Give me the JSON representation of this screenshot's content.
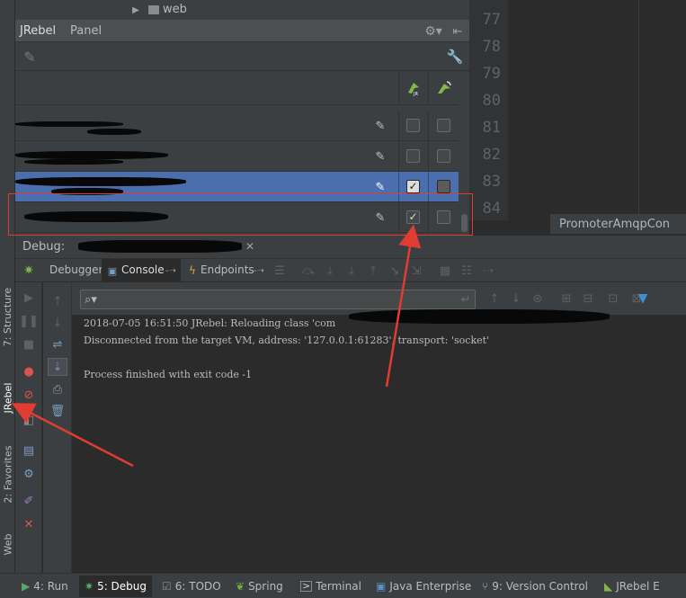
{
  "tree": {
    "folder": "web"
  },
  "panel": {
    "tabs": [
      "JRebel",
      "Panel"
    ],
    "rows": [
      {
        "enabled": false,
        "remote": false,
        "selected": false
      },
      {
        "enabled": false,
        "remote": false,
        "selected": false
      },
      {
        "enabled": true,
        "remote": false,
        "selected": true
      },
      {
        "enabled": true,
        "remote": false,
        "selected": false
      }
    ]
  },
  "editor": {
    "line_numbers": [
      "77",
      "78",
      "79",
      "80",
      "81",
      "82",
      "83",
      "84"
    ],
    "breadcrumb": "PromoterAmqpCon"
  },
  "debug": {
    "label": "Debug:",
    "tabs": [
      "Debugger",
      "Console",
      "Endpoints"
    ],
    "console_lines": [
      "2018-07-05 16:51:50 JRebel: Reloading class 'com",
      "Disconnected from the target VM, address: '127.0.0.1:61283', transport: 'socket'",
      "",
      "Process finished with exit code -1"
    ]
  },
  "left_strip": {
    "tabs": [
      "7: Structure",
      "JRebel",
      "2: Favorites",
      "Web"
    ]
  },
  "bottom_tabs": [
    {
      "label": "4: Run",
      "icon": "run-icon"
    },
    {
      "label": "5: Debug",
      "icon": "debug-icon"
    },
    {
      "label": "6: TODO",
      "icon": "todo-icon"
    },
    {
      "label": "Spring",
      "icon": "spring-icon"
    },
    {
      "label": "Terminal",
      "icon": "terminal-icon"
    },
    {
      "label": "Java Enterprise",
      "icon": "java-enterprise-icon"
    },
    {
      "label": "9: Version Control",
      "icon": "version-control-icon"
    },
    {
      "label": "JRebel E",
      "icon": "jrebel-executor-icon"
    }
  ],
  "colors": {
    "selection": "#4b6eaf",
    "annotation": "#e03c31",
    "background": "#2b2b2b"
  }
}
